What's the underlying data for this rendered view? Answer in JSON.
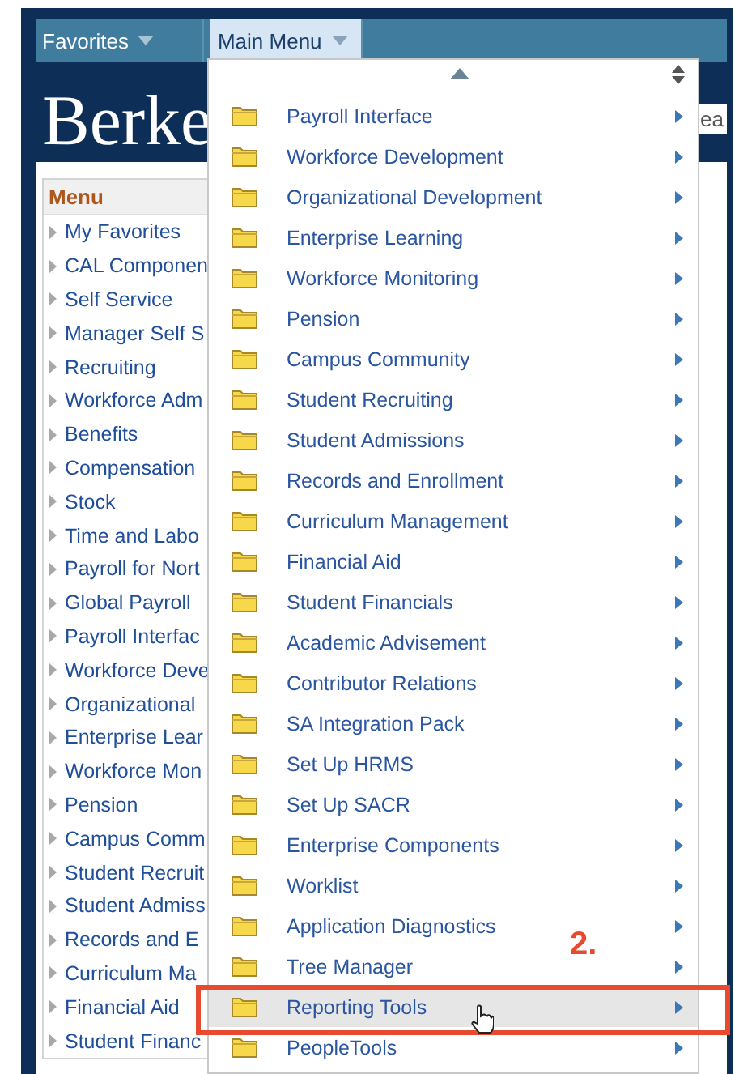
{
  "top_bar": {
    "tabs": [
      {
        "label": "Favorites",
        "selected": false
      },
      {
        "label": "Main Menu",
        "selected": true
      }
    ]
  },
  "header": {
    "logo": "Berke",
    "search_fragment": "ea"
  },
  "menu": {
    "title": "Menu",
    "items": [
      "My Favorites",
      "CAL Componen",
      "Self Service",
      "Manager Self S",
      "Recruiting",
      "Workforce Adm",
      "Benefits",
      "Compensation",
      "Stock",
      "Time and Labo",
      "Payroll for Nort",
      "Global Payroll",
      "Payroll Interfac",
      "Workforce Deve",
      "Organizational",
      "Enterprise Lear",
      "Workforce Mon",
      "Pension",
      "Campus Comm",
      "Student Recruit",
      "Student Admiss",
      "Records and E",
      "Curriculum Ma",
      "Financial Aid",
      "Student Financ"
    ]
  },
  "dropdown": {
    "items": [
      {
        "label": "Payroll Interface",
        "selected": false
      },
      {
        "label": "Workforce Development",
        "selected": false
      },
      {
        "label": "Organizational Development",
        "selected": false
      },
      {
        "label": "Enterprise Learning",
        "selected": false
      },
      {
        "label": "Workforce Monitoring",
        "selected": false
      },
      {
        "label": "Pension",
        "selected": false
      },
      {
        "label": "Campus Community",
        "selected": false
      },
      {
        "label": "Student Recruiting",
        "selected": false
      },
      {
        "label": "Student Admissions",
        "selected": false
      },
      {
        "label": "Records and Enrollment",
        "selected": false
      },
      {
        "label": "Curriculum Management",
        "selected": false
      },
      {
        "label": "Financial Aid",
        "selected": false
      },
      {
        "label": "Student Financials",
        "selected": false
      },
      {
        "label": "Academic Advisement",
        "selected": false
      },
      {
        "label": "Contributor Relations",
        "selected": false
      },
      {
        "label": "SA Integration Pack",
        "selected": false
      },
      {
        "label": "Set Up HRMS",
        "selected": false
      },
      {
        "label": "Set Up SACR",
        "selected": false
      },
      {
        "label": "Enterprise Components",
        "selected": false
      },
      {
        "label": "Worklist",
        "selected": false
      },
      {
        "label": "Application Diagnostics",
        "selected": false
      },
      {
        "label": "Tree Manager",
        "selected": false
      },
      {
        "label": "Reporting Tools",
        "selected": true
      },
      {
        "label": "PeopleTools",
        "selected": false
      }
    ]
  },
  "annotation": {
    "label": "2."
  }
}
